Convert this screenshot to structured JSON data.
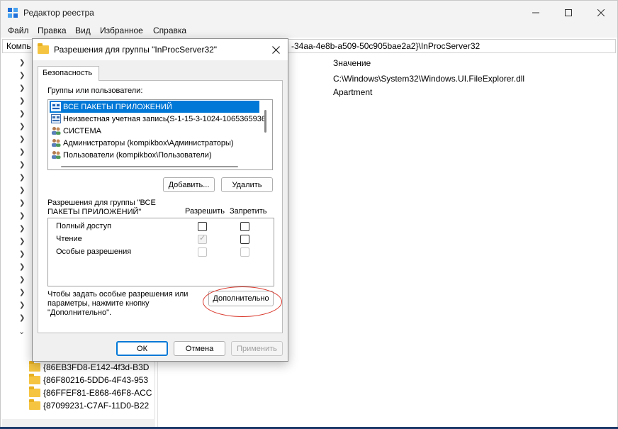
{
  "window": {
    "title": "Редактор реестра",
    "app_icon": "regedit-icon",
    "controls": {
      "minimize": "minimize-icon",
      "maximize": "maximize-icon",
      "close": "close-icon"
    }
  },
  "menu": [
    "Файл",
    "Правка",
    "Вид",
    "Избранное",
    "Справка"
  ],
  "address": {
    "left_part": "Компь",
    "right_part": "-34aa-4e8b-a509-50c905bae2a2}\\InProcServer32"
  },
  "tree": {
    "items": [
      {
        "label": "{86EB3FD8-E142-4f3d-B3D"
      },
      {
        "label": "{86F80216-5DD6-4F43-953"
      },
      {
        "label": "{86FFEF81-E868-46F8-ACC"
      },
      {
        "label": "{87099231-C7AF-11D0-B22"
      }
    ]
  },
  "values_pane": {
    "header": "Значение",
    "rows": [
      "C:\\Windows\\System32\\Windows.UI.FileExplorer.dll",
      "Apartment"
    ]
  },
  "dialog": {
    "title": "Разрешения для группы \"InProcServer32\"",
    "tab": "Безопасность",
    "groups_label": "Группы или пользователи:",
    "groups": [
      {
        "label": "ВСЕ ПАКЕТЫ ПРИЛОЖЕНИЙ",
        "icon": "app-packages-icon",
        "selected": true
      },
      {
        "label": "Неизвестная учетная запись(S-1-15-3-1024-1065365936",
        "icon": "unknown-account-icon",
        "selected": false
      },
      {
        "label": "СИСТЕМА",
        "icon": "group-users-icon",
        "selected": false
      },
      {
        "label": "Администраторы (kompikbox\\Администраторы)",
        "icon": "group-users-icon",
        "selected": false
      },
      {
        "label": "Пользователи (kompikbox\\Пользователи)",
        "icon": "group-users-icon",
        "selected": false
      }
    ],
    "add_button": "Добавить...",
    "remove_button": "Удалить",
    "perm_label_line1": "Разрешения для группы \"ВСЕ",
    "perm_label_line2": "ПАКЕТЫ ПРИЛОЖЕНИЙ\"",
    "allow_header": "Разрешить",
    "deny_header": "Запретить",
    "permissions": [
      {
        "name": "Полный доступ",
        "allow": false,
        "deny": false,
        "enabled": true
      },
      {
        "name": "Чтение",
        "allow": true,
        "deny": false,
        "enabled": true
      },
      {
        "name": "Особые разрешения",
        "allow": false,
        "deny": false,
        "enabled": false
      }
    ],
    "advanced_text_line1": "Чтобы задать особые разрешения или",
    "advanced_text_line2": "параметры, нажмите кнопку",
    "advanced_text_line3": "\"Дополнительно\".",
    "advanced_button": "Дополнительно",
    "ok_button": "ОК",
    "cancel_button": "Отмена",
    "apply_button": "Применить",
    "highlight_color": "#d9382c"
  }
}
